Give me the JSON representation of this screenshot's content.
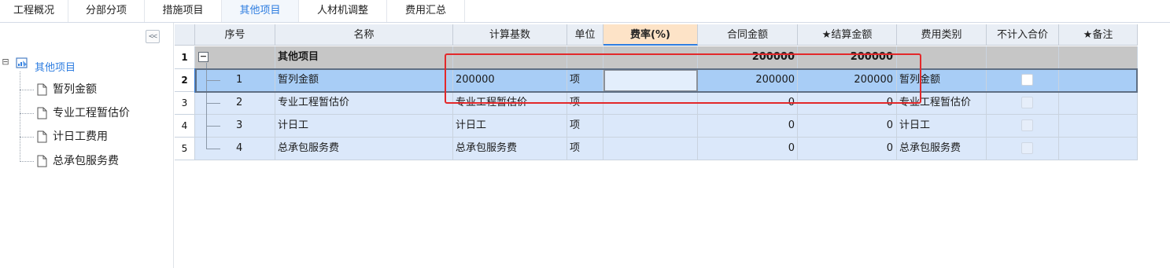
{
  "tabs": [
    {
      "label": "工程概况",
      "active": false
    },
    {
      "label": "分部分项",
      "active": false
    },
    {
      "label": "措施项目",
      "active": false
    },
    {
      "label": "其他项目",
      "active": true
    },
    {
      "label": "人材机调整",
      "active": false
    },
    {
      "label": "费用汇总",
      "active": false
    }
  ],
  "tree": {
    "collapse_label": "<<",
    "root": {
      "label": "其他项目",
      "icon": "folder-chart-icon"
    },
    "children": [
      {
        "label": "暂列金额",
        "icon": "document-icon"
      },
      {
        "label": "专业工程暂估价",
        "icon": "document-icon"
      },
      {
        "label": "计日工费用",
        "icon": "document-icon"
      },
      {
        "label": "总承包服务费",
        "icon": "document-icon"
      }
    ]
  },
  "grid": {
    "columns": {
      "seq": "序号",
      "name": "名称",
      "base": "计算基数",
      "unit": "单位",
      "rate": "费率(%)",
      "contract": "合同金额",
      "settle": "★结算金额",
      "category": "费用类别",
      "exclude": "不计入合价",
      "remark": "★备注"
    },
    "rows": [
      {
        "rownum": "1",
        "seq": "",
        "name": "其他项目",
        "base": "",
        "unit": "",
        "rate": "",
        "contract": "200000",
        "settle": "200000",
        "category": "",
        "toggle": "−"
      },
      {
        "rownum": "2",
        "seq": "1",
        "name": "暂列金额",
        "base": "200000",
        "unit": "项",
        "rate": "",
        "contract": "200000",
        "settle": "200000",
        "category": "暂列金额"
      },
      {
        "rownum": "3",
        "seq": "2",
        "name": "专业工程暂估价",
        "base": "专业工程暂估价",
        "unit": "项",
        "rate": "",
        "contract": "0",
        "settle": "0",
        "category": "专业工程暂估价"
      },
      {
        "rownum": "4",
        "seq": "3",
        "name": "计日工",
        "base": "计日工",
        "unit": "项",
        "rate": "",
        "contract": "0",
        "settle": "0",
        "category": "计日工"
      },
      {
        "rownum": "5",
        "seq": "4",
        "name": "总承包服务费",
        "base": "总承包服务费",
        "unit": "项",
        "rate": "",
        "contract": "0",
        "settle": "0",
        "category": "总承包服务费"
      }
    ]
  },
  "colors": {
    "accent": "#2e7de0",
    "selected_row": "#a8cdf6",
    "group_row": "#c6c6c6",
    "child_row": "#dbe8fa",
    "rate_header": "#fde3c7",
    "annotation": "#e3282a"
  }
}
